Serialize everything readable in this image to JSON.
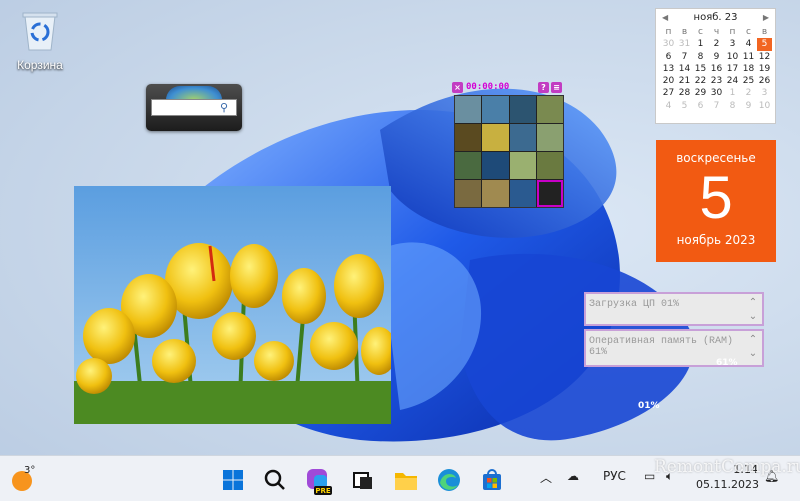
{
  "desktop": {
    "recycle_bin_label": "Корзина"
  },
  "puzzle": {
    "timer": "00:00:00",
    "help": "?",
    "menu": "≡"
  },
  "calendar": {
    "month_title": "нояб. 23",
    "weekdays": [
      "п",
      "в",
      "с",
      "ч",
      "п",
      "с",
      "в"
    ],
    "weeks": [
      [
        "30",
        "31",
        "1",
        "2",
        "3",
        "4",
        "5"
      ],
      [
        "6",
        "7",
        "8",
        "9",
        "10",
        "11",
        "12"
      ],
      [
        "13",
        "14",
        "15",
        "16",
        "17",
        "18",
        "19"
      ],
      [
        "20",
        "21",
        "22",
        "23",
        "24",
        "25",
        "26"
      ],
      [
        "27",
        "28",
        "29",
        "30",
        "1",
        "2",
        "3"
      ],
      [
        "4",
        "5",
        "6",
        "7",
        "8",
        "9",
        "10"
      ]
    ],
    "today": "5"
  },
  "date_gadget": {
    "weekday": "воскресенье",
    "day": "5",
    "month_year": "ноябрь 2023"
  },
  "system_meter": {
    "cpu_label": "Загрузка ЦП 01%",
    "ram_label": "Оперативная память (RAM) 61%",
    "ram_pct": "61%",
    "cpu_pct": "01%"
  },
  "taskbar": {
    "weather_temp": "3°",
    "language": "РУС",
    "time": "1:14",
    "date": "05.11.2023",
    "apps": [
      "start",
      "search",
      "copilot-pre",
      "task-view",
      "file-explorer",
      "edge",
      "store"
    ]
  },
  "watermark": "RemontCompa.ru",
  "colors": {
    "accent_orange": "#f25a12",
    "magenta": "#c800c8",
    "taskbar_bg": "#eef1f6"
  }
}
